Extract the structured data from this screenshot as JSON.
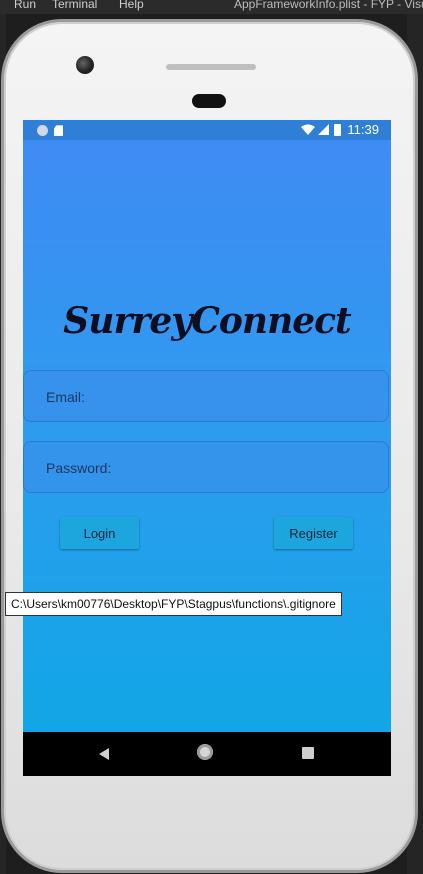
{
  "ide": {
    "menu": [
      "Run",
      "Terminal",
      "Help"
    ],
    "title": "AppFrameworkInfo.plist - FYP - Visu"
  },
  "statusbar": {
    "time": "11:39"
  },
  "app": {
    "brand": "SurreyConnect",
    "email_placeholder": "Email:",
    "password_placeholder": "Password:",
    "login_label": "Login",
    "register_label": "Register"
  },
  "tooltip": "C:\\Users\\km00776\\Desktop\\FYP\\Stagpus\\functions\\.gitignore",
  "colors": {
    "gradient_top": "#3f8bf4",
    "gradient_bottom": "#11a6e6",
    "button": "#1da6de",
    "statusbar": "#2f7fd6"
  },
  "icons": [
    "notification-circle-icon",
    "sd-card-icon",
    "wifi-icon",
    "cell-signal-icon",
    "battery-icon",
    "back-icon",
    "home-icon",
    "recents-icon"
  ]
}
